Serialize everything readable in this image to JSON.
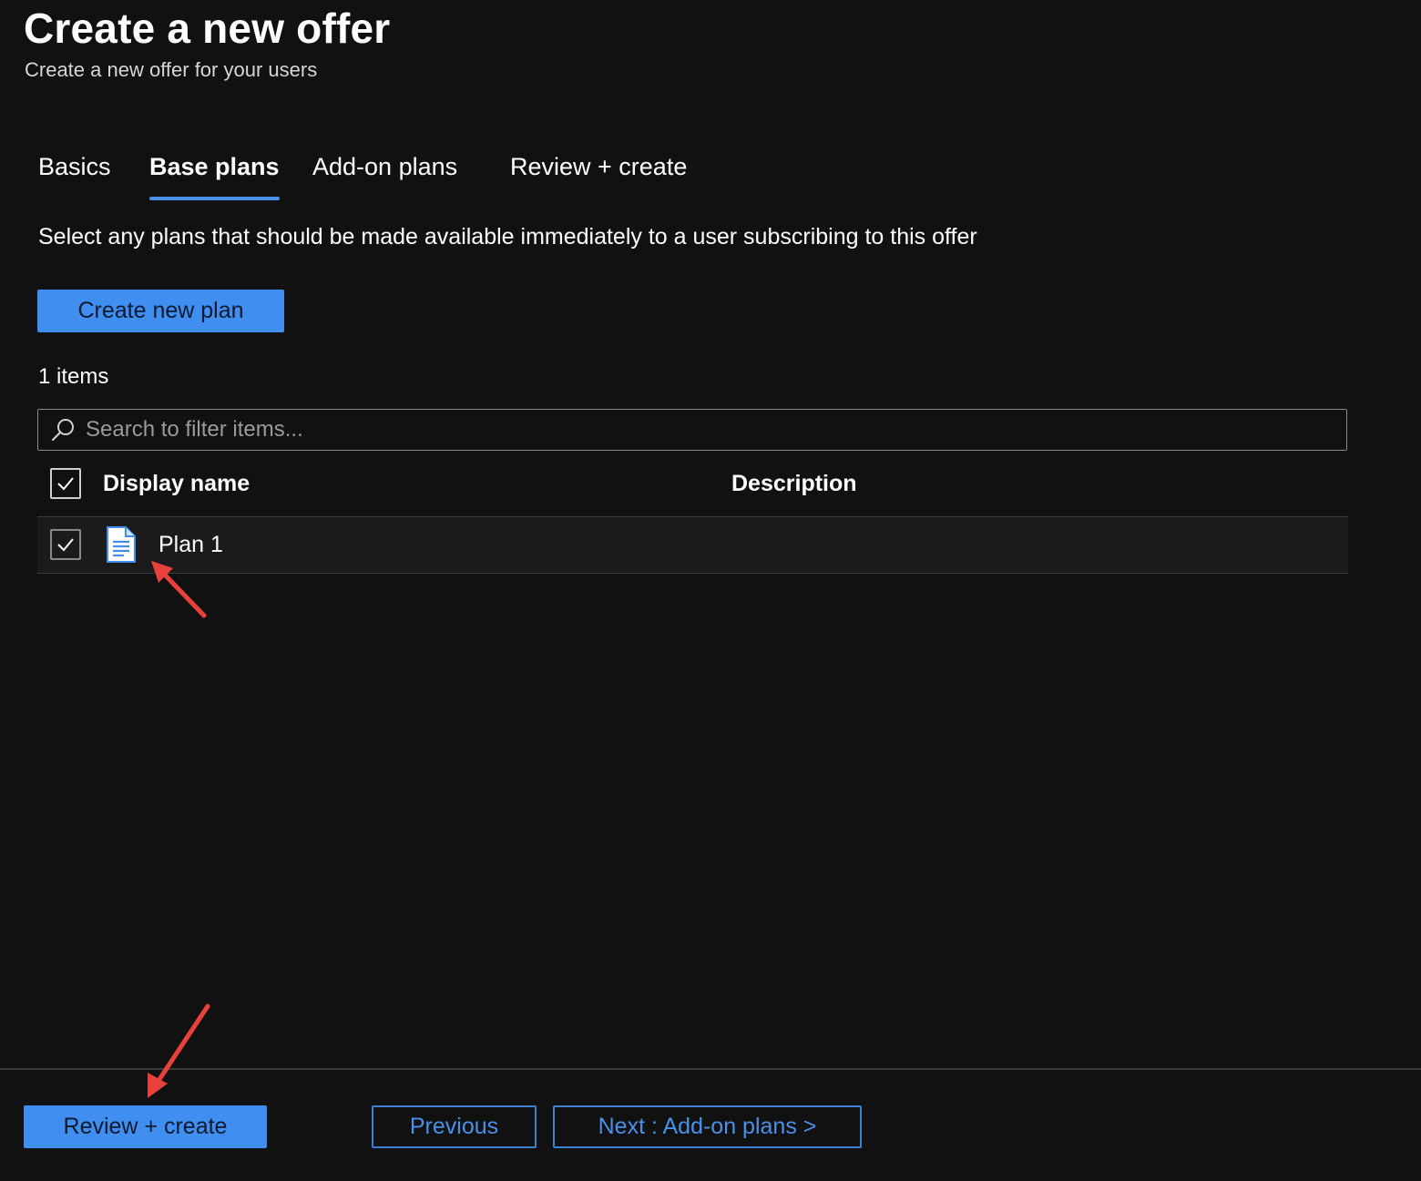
{
  "header": {
    "title": "Create a new offer",
    "subtitle": "Create a new offer for your users"
  },
  "tabs": [
    {
      "label": "Basics",
      "active": false
    },
    {
      "label": "Base plans",
      "active": true
    },
    {
      "label": "Add-on plans",
      "active": false
    },
    {
      "label": "Review + create",
      "active": false
    }
  ],
  "main": {
    "instruction": "Select any plans that should be made available immediately to a user subscribing to this offer",
    "create_plan_label": "Create new plan",
    "items_count": "1 items",
    "search": {
      "placeholder": "Search to filter items...",
      "value": ""
    },
    "table": {
      "columns": [
        "Display name",
        "Description"
      ],
      "header_checked": true,
      "rows": [
        {
          "name": "Plan 1",
          "description": "",
          "checked": true,
          "icon": "document-icon"
        }
      ]
    }
  },
  "footer": {
    "review_create_label": "Review + create",
    "previous_label": "Previous",
    "next_label": "Next : Add-on plans >"
  },
  "colors": {
    "background": "#111111",
    "accent": "#3f8ef0",
    "annotation_arrow": "#e8413c"
  }
}
